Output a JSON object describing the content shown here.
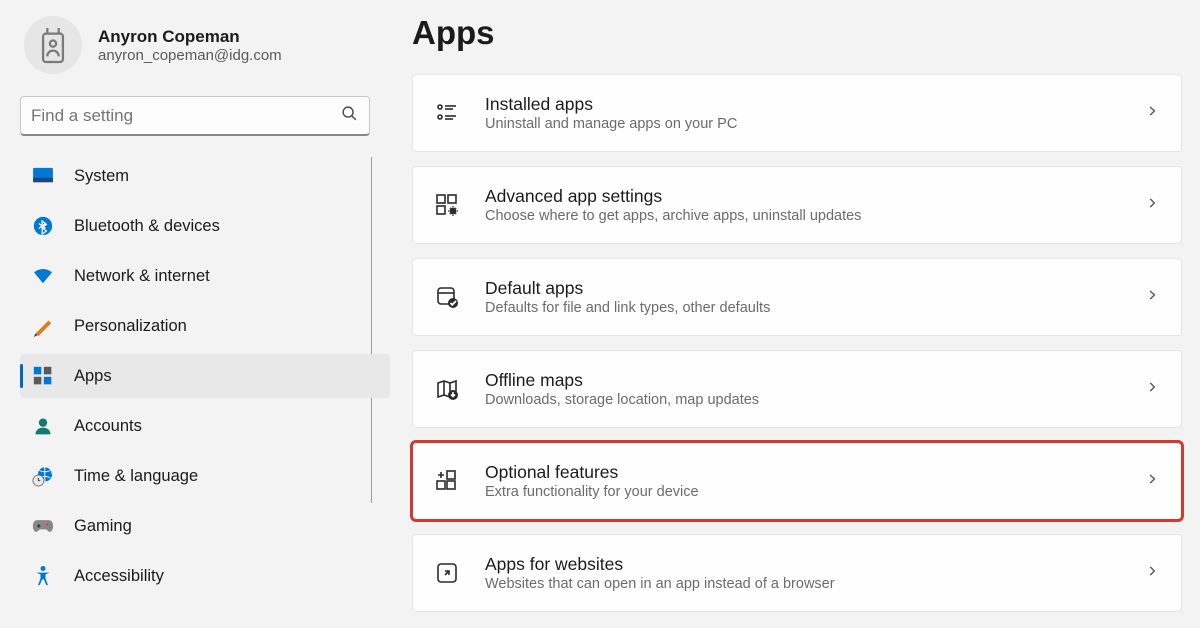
{
  "profile": {
    "name": "Anyron Copeman",
    "email": "anyron_copeman@idg.com"
  },
  "search": {
    "placeholder": "Find a setting"
  },
  "sidebar": {
    "items": [
      {
        "label": "System",
        "icon": "system"
      },
      {
        "label": "Bluetooth & devices",
        "icon": "bluetooth"
      },
      {
        "label": "Network & internet",
        "icon": "wifi"
      },
      {
        "label": "Personalization",
        "icon": "personalization"
      },
      {
        "label": "Apps",
        "icon": "apps",
        "selected": true
      },
      {
        "label": "Accounts",
        "icon": "accounts"
      },
      {
        "label": "Time & language",
        "icon": "time-language"
      },
      {
        "label": "Gaming",
        "icon": "gaming"
      },
      {
        "label": "Accessibility",
        "icon": "accessibility"
      }
    ]
  },
  "page": {
    "title": "Apps"
  },
  "cards": [
    {
      "title": "Installed apps",
      "sub": "Uninstall and manage apps on your PC",
      "icon": "installed-apps"
    },
    {
      "title": "Advanced app settings",
      "sub": "Choose where to get apps, archive apps, uninstall updates",
      "icon": "advanced-apps"
    },
    {
      "title": "Default apps",
      "sub": "Defaults for file and link types, other defaults",
      "icon": "default-apps"
    },
    {
      "title": "Offline maps",
      "sub": "Downloads, storage location, map updates",
      "icon": "offline-maps"
    },
    {
      "title": "Optional features",
      "sub": "Extra functionality for your device",
      "icon": "optional-features",
      "highlighted": true
    },
    {
      "title": "Apps for websites",
      "sub": "Websites that can open in an app instead of a browser",
      "icon": "apps-websites"
    }
  ]
}
